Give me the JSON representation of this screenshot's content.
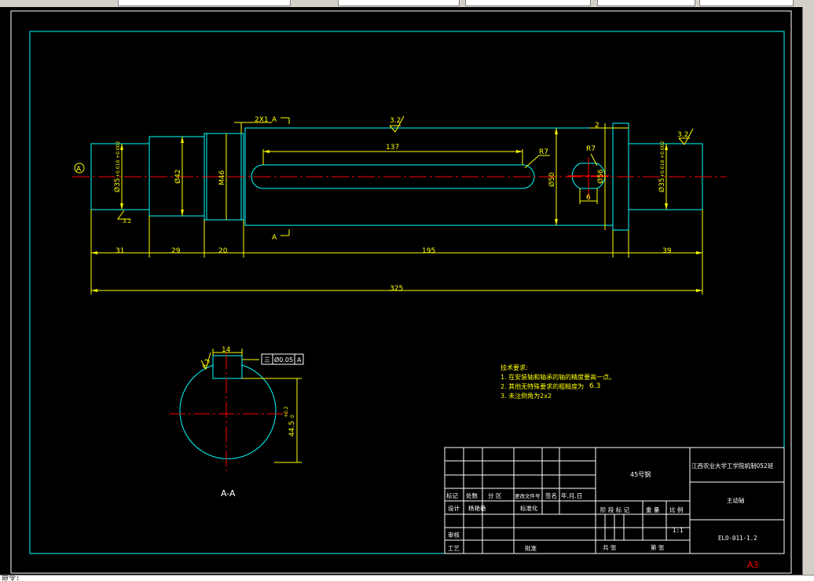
{
  "drawing": {
    "sheet_size": "A3",
    "view_section_label": "A-A",
    "datum_symbol": "A",
    "section_marks": [
      "A",
      "A"
    ],
    "chamfer_note": "2X1",
    "key_width_label": "14",
    "key_depth_label": "44.5",
    "key_depth_tolerance": [
      "+0.2",
      "0"
    ],
    "geometric_tolerance": {
      "symbol": "三",
      "value": "Ø0.05",
      "datum": "A"
    },
    "roughness_top": "3.2",
    "roughness_right": "3.2",
    "roughness_left": "3.2",
    "roughness_section": "6.3",
    "slot_length_label": "137",
    "slot_radius_1": "R7",
    "slot_radius_2": "R7",
    "slot_width_label": "6",
    "shoulder_offset_label": "2",
    "diameter_labels": {
      "left_journal": "Ø35",
      "left_journal_tol": "+0.018 +0.002",
      "d42": "Ø42",
      "thread": "M46",
      "d50": "Ø50",
      "d56": "Ø56",
      "right_journal": "Ø35",
      "right_journal_tol": "+0.018 +0.002"
    },
    "length_dims": [
      "31",
      "29",
      "20",
      "195",
      "39"
    ],
    "total_length": "325",
    "tech_requirements": {
      "title": "技术要求:",
      "items": [
        "1. 在安装轴和轴承的轴的精度要高一点。",
        "2. 其他无特殊要求的粗糙度为",
        "3. 未注倒角为2x2"
      ],
      "item2_roughness": "6.3"
    },
    "title_block": {
      "material": "45号钢",
      "school": "江西农业大学工学院机制052班",
      "part_name": "主动轴",
      "drawing_no": "ELO-011-1.2",
      "scale": "1:1",
      "row_labels": {
        "mark": "标记",
        "count": "处数",
        "zone": "分 区",
        "doc_no": "更改文件号",
        "sign": "签名",
        "date": "年.月.日",
        "design": "设计",
        "designer": "杨艳艳",
        "standard": "标准化",
        "review": "审核",
        "process": "工艺",
        "approve": "批准",
        "stage_mark": "阶 段 标 记",
        "weight": "重 量",
        "ratio": "比 例",
        "total_sheets": "共    张",
        "sheet_no": "第    张"
      }
    }
  },
  "colors": {
    "background": "#000000",
    "border": "#00ffff",
    "dimension": "#ffff00",
    "centerline": "#ff0000",
    "outline": "#00ffff",
    "sheet_label": "#ff0000"
  },
  "command_line": "命令:"
}
